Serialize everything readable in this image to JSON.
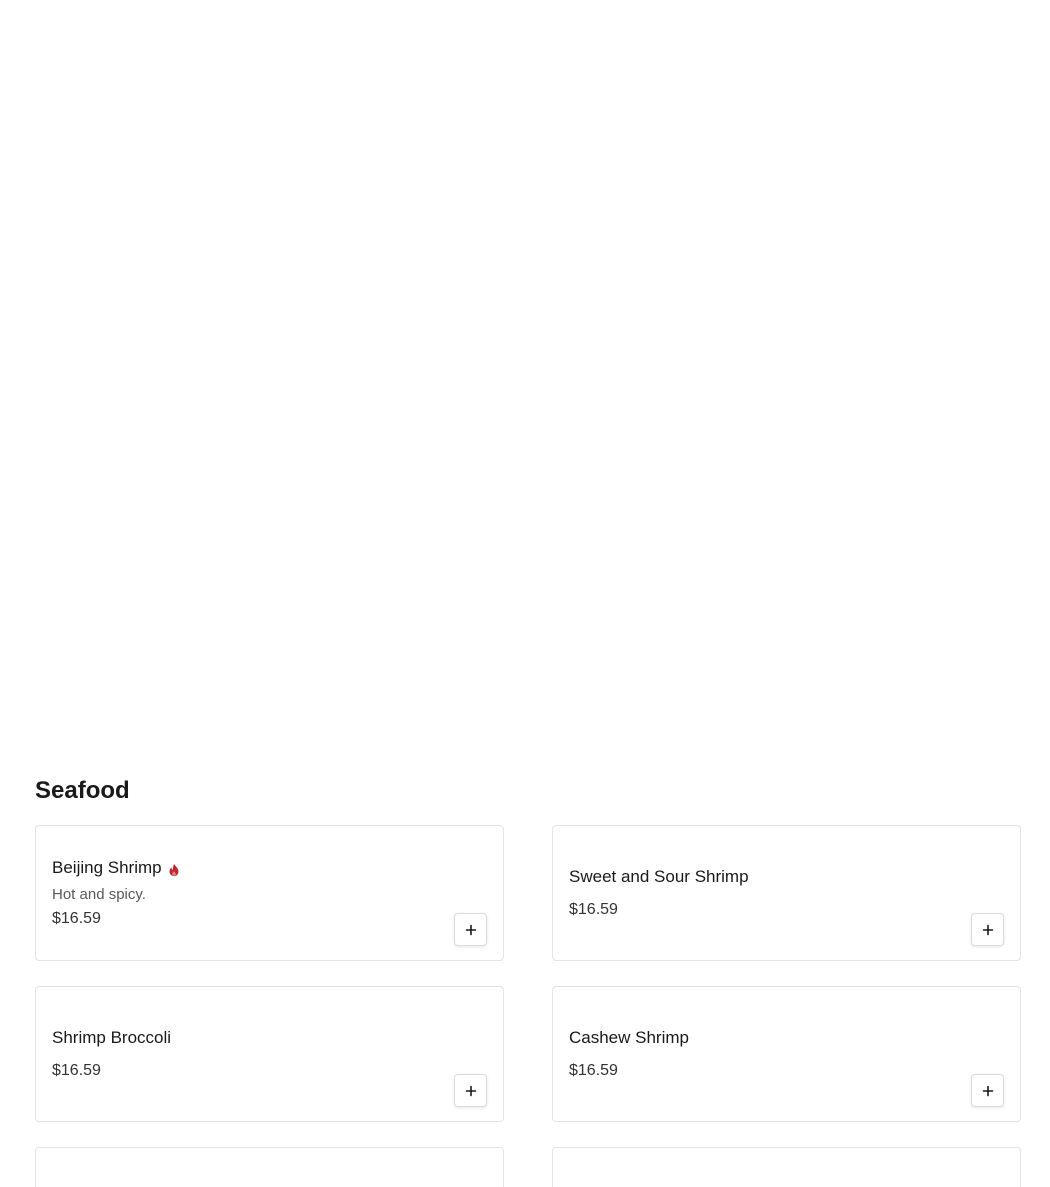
{
  "section": {
    "title": "Seafood"
  },
  "items": [
    {
      "name": "Beijing Shrimp",
      "description": "Hot and spicy.",
      "price": "$16.59",
      "spicy": true
    },
    {
      "name": "Sweet and Sour Shrimp",
      "description": "",
      "price": "$16.59",
      "spicy": false
    },
    {
      "name": "Shrimp Broccoli",
      "description": "",
      "price": "$16.59",
      "spicy": false
    },
    {
      "name": "Cashew Shrimp",
      "description": "",
      "price": "$16.59",
      "spicy": false
    }
  ],
  "icons": {
    "spicy": "flame-icon",
    "add": "plus-icon"
  },
  "colors": {
    "spicy": "#c0282d",
    "border": "#e3e3e3",
    "text": "#191919"
  }
}
